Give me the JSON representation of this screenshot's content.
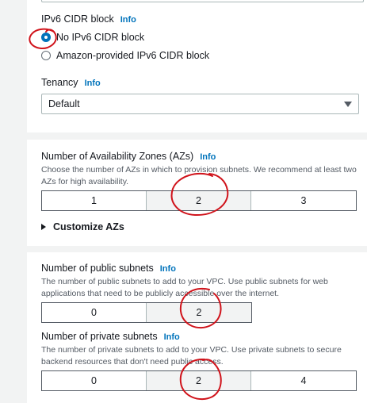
{
  "ipv6": {
    "label": "IPv6 CIDR block",
    "info": "Info",
    "options": [
      "No IPv6 CIDR block",
      "Amazon-provided IPv6 CIDR block"
    ],
    "selected": "No IPv6 CIDR block"
  },
  "tenancy": {
    "label": "Tenancy",
    "info": "Info",
    "value": "Default"
  },
  "azs": {
    "label": "Number of Availability Zones (AZs)",
    "info": "Info",
    "description": "Choose the number of AZs in which to provision subnets. We recommend at least two AZs for high availability.",
    "options": [
      "1",
      "2",
      "3"
    ],
    "selected": "2",
    "customize_label": "Customize AZs"
  },
  "public_subnets": {
    "label": "Number of public subnets",
    "info": "Info",
    "description": "The number of public subnets to add to your VPC. Use public subnets for web applications that need to be publicly accessible over the internet.",
    "options": [
      "0",
      "2"
    ],
    "selected": "2"
  },
  "private_subnets": {
    "label": "Number of private subnets",
    "info": "Info",
    "description": "The number of private subnets to add to your VPC. Use private subnets to secure backend resources that don't need public access.",
    "options": [
      "0",
      "2",
      "4"
    ],
    "selected": "2"
  },
  "colors": {
    "accent": "#0073bb",
    "annotation": "#d0131b",
    "page_bg": "#f2f3f3"
  }
}
